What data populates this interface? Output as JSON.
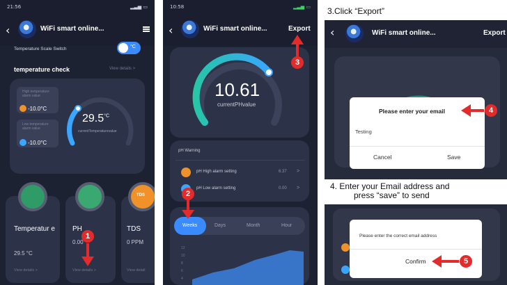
{
  "panel1": {
    "status_time": "21:56",
    "title": "WiFi smart online...",
    "switch_label": "Temperature Scale Switch",
    "switch_value": "°C",
    "section_title": "temperature check",
    "view_details": "View details >",
    "high_label": "High temperature alarm value",
    "high_value": "-10.0°C",
    "low_label": "Low temperature alarm value",
    "low_value": "-10.0°C",
    "temp_value": "29.5",
    "temp_unit": "°C",
    "temp_caption": "currentTemperaturevalue",
    "tiles": [
      {
        "name": "Temperatur e",
        "value": "29.5 °C",
        "link": "View details >"
      },
      {
        "name": "PH",
        "value": "0.00",
        "link": "View details >"
      },
      {
        "name": "TDS",
        "value": "0 PPM",
        "link": "View detail"
      }
    ],
    "tds_badge": "TDS",
    "step_number": "1"
  },
  "panel2": {
    "status_time": "10:58",
    "title": "WiFi smart online...",
    "export_label": "Export",
    "gauge_value": "10.61",
    "gauge_caption": "currentPHvalue",
    "warning_title": "pH Warning",
    "rows": [
      {
        "label": "pH High alarm setting",
        "value": "6.37",
        "chevron": ">"
      },
      {
        "label": "pH Low alarm setting",
        "value": "0.00",
        "chevron": ">"
      }
    ],
    "tabs": [
      "Weeks",
      "Days",
      "Month",
      "Hour"
    ],
    "axis_ticks": [
      "12",
      "10",
      "8",
      "6",
      "4",
      "2"
    ],
    "step_number_export": "3",
    "step_number_tabs": "2"
  },
  "panel3": {
    "caption": "3.Click “Export”",
    "title": "WiFi smart online...",
    "export_label": "Export",
    "dialog_title": "Please enter your email",
    "input_value": "Testing",
    "cancel": "Cancel",
    "save": "Save",
    "step_number": "4"
  },
  "panel4": {
    "caption_line1": "4. Enter your Email address and",
    "caption_line2": "press “save” to send",
    "dialog_text": "Please enter the correct email address",
    "confirm": "Confirm",
    "step_number": "5"
  },
  "colors": {
    "background": "#1d2233",
    "card": "#2c3247",
    "accent_blue": "#3aa6ff",
    "gauge_green": "#27c6a7",
    "orange": "#f0912a",
    "red_annotation": "#e32b2b"
  }
}
